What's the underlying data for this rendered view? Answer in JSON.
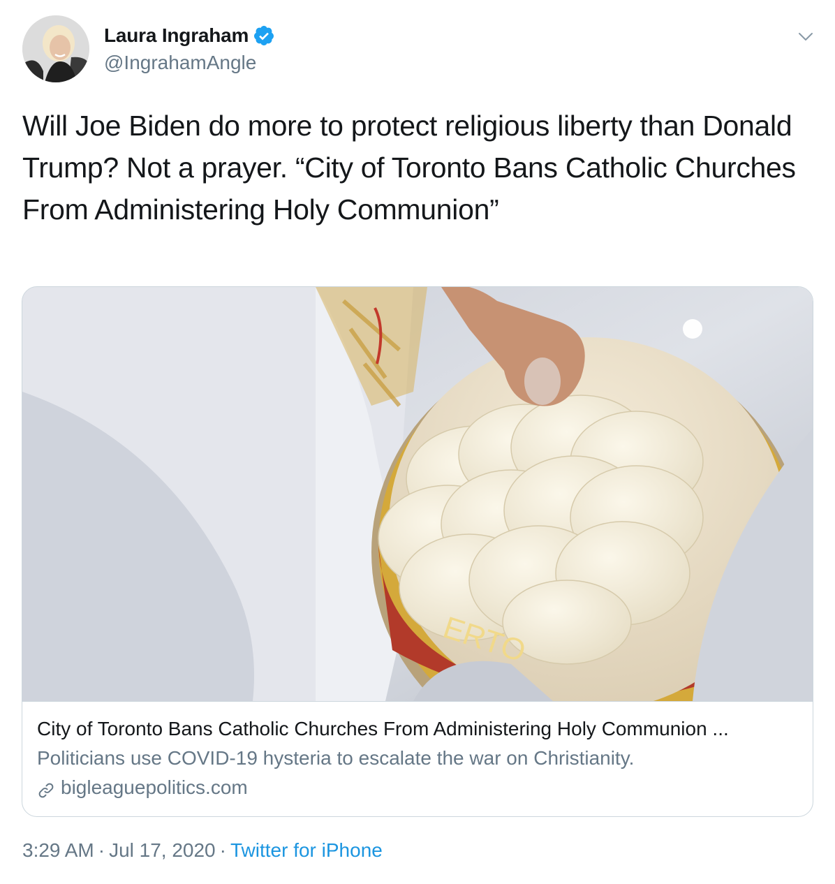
{
  "author": {
    "display_name": "Laura Ingraham",
    "handle": "@IngrahamAngle",
    "verified": true
  },
  "tweet": {
    "text": "Will Joe Biden do more to protect religious liberty than Donald Trump? Not a prayer. “City of Toronto Bans Catholic Churches From Administering Holy Communion”"
  },
  "card": {
    "title": "City of Toronto Bans Catholic Churches From Administering Holy Communion ...",
    "description": "Politicians use COVID-19 hysteria to escalate the war on Christianity.",
    "domain": "bigleaguepolitics.com",
    "bowl_lettering": "ERTO"
  },
  "meta": {
    "time": "3:29 AM",
    "separator": "·",
    "date": "Jul 17, 2020",
    "source": "Twitter for iPhone"
  },
  "colors": {
    "text": "#14171a",
    "secondary": "#657786",
    "link": "#1b95e0",
    "verified": "#1da1f2",
    "border": "#ccd6dd"
  },
  "icons": {
    "verified": "verified-badge-icon",
    "menu": "chevron-down-icon",
    "link": "link-icon"
  }
}
